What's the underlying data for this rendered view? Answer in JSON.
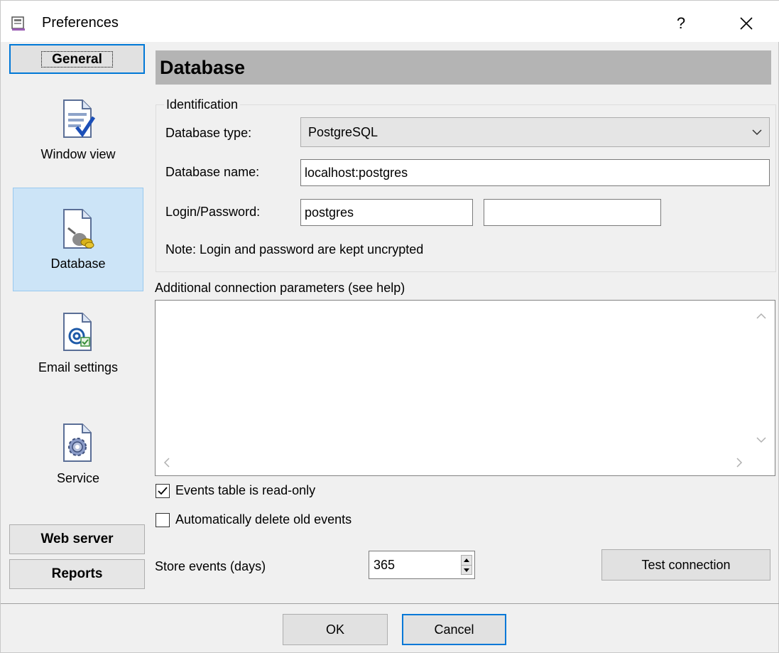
{
  "window": {
    "title": "Preferences",
    "help_label": "?"
  },
  "sidebar": {
    "general_label": "General",
    "items": [
      {
        "label": "Window view",
        "icon": "window-view-icon"
      },
      {
        "label": "Database",
        "icon": "database-plug-icon"
      },
      {
        "label": "Email settings",
        "icon": "email-icon"
      },
      {
        "label": "Service",
        "icon": "service-gear-icon"
      }
    ],
    "web_server_label": "Web server",
    "reports_label": "Reports"
  },
  "section": {
    "title": "Database"
  },
  "identification": {
    "legend": "Identification",
    "db_type_label": "Database type:",
    "db_type_value": "PostgreSQL",
    "db_name_label": "Database name:",
    "db_name_value": "localhost:postgres",
    "login_label": "Login/Password:",
    "login_value": "postgres",
    "password_value": "",
    "note": "Note: Login and password are kept uncrypted"
  },
  "params": {
    "label": "Additional connection parameters (see help)",
    "value": ""
  },
  "options": {
    "readonly_label": "Events table is read-only",
    "readonly_checked": true,
    "autodelete_label": "Automatically delete old events",
    "autodelete_checked": false,
    "store_label": "Store events (days)",
    "store_value": "365"
  },
  "buttons": {
    "test_connection": "Test connection",
    "ok": "OK",
    "cancel": "Cancel"
  },
  "colors": {
    "accent": "#0078d7",
    "selected_bg": "#cce4f7",
    "header_bg": "#b4b4b4"
  }
}
